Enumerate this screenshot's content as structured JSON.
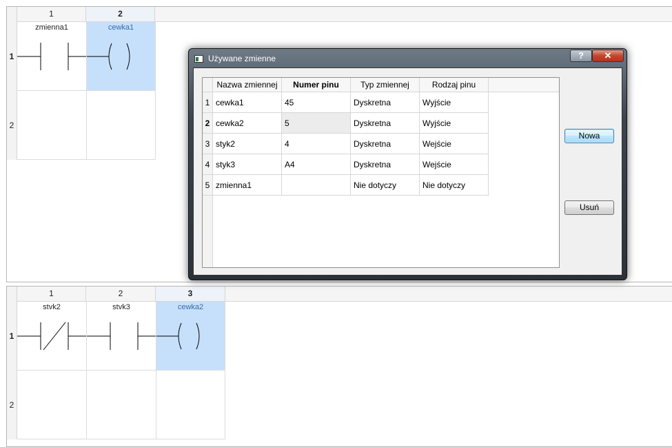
{
  "diagram1": {
    "columns": [
      "1",
      "2"
    ],
    "rows": [
      "1",
      "2"
    ],
    "cells": [
      {
        "label": "zmienna1",
        "type": "contact-no"
      },
      {
        "label": "cewka1",
        "type": "coil"
      }
    ]
  },
  "diagram2": {
    "columns": [
      "1",
      "2",
      "3"
    ],
    "rows": [
      "1",
      "2"
    ],
    "cells": [
      {
        "label": "stvk2",
        "type": "contact-nc"
      },
      {
        "label": "stvk3",
        "type": "contact-no"
      },
      {
        "label": "cewka2",
        "type": "coil"
      }
    ]
  },
  "dialog": {
    "title": "Używane zmienne",
    "help_label": "?",
    "close_label": "✕",
    "columns": [
      "Nazwa zmiennej",
      "Numer pinu",
      "Typ zmiennej",
      "Rodzaj pinu"
    ],
    "rows": [
      {
        "num": "1",
        "cells": [
          "cewka1",
          "45",
          "Dyskretna",
          "Wyjście"
        ]
      },
      {
        "num": "2",
        "cells": [
          "cewka2",
          "5",
          "Dyskretna",
          "Wyjście"
        ]
      },
      {
        "num": "3",
        "cells": [
          "styk2",
          "4",
          "Dyskretna",
          "Wejście"
        ]
      },
      {
        "num": "4",
        "cells": [
          "styk3",
          "A4",
          "Dyskretna",
          "Wejście"
        ]
      },
      {
        "num": "5",
        "cells": [
          "zmienna1",
          "",
          "Nie dotyczy",
          "Nie dotyczy"
        ]
      }
    ],
    "new_button": "Nowa",
    "delete_button": "Usuń"
  },
  "colors": {
    "selected_cell": "#c6e0fc",
    "dialog_frame": "#2b323a"
  }
}
